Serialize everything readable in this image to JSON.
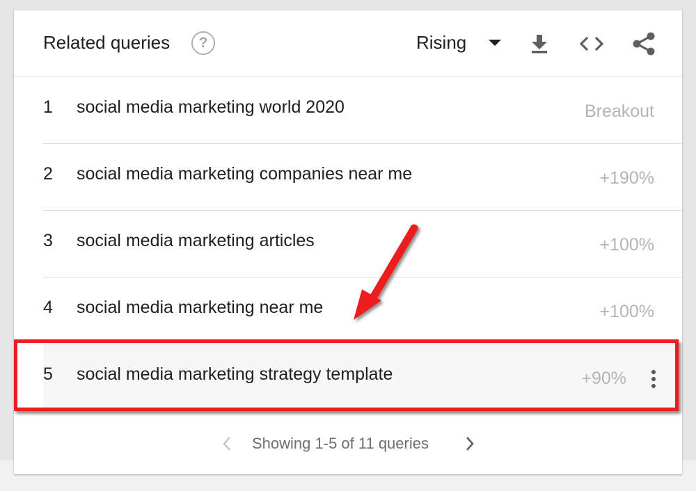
{
  "widget": {
    "title": "Related queries",
    "help_icon": "help-circle-icon",
    "filter": {
      "selected": "Rising"
    },
    "toolbar": {
      "download_icon": "download-icon",
      "embed_icon": "embed-code-icon",
      "share_icon": "share-icon"
    }
  },
  "rows": [
    {
      "rank": "1",
      "query": "social media marketing world 2020",
      "value": "Breakout"
    },
    {
      "rank": "2",
      "query": "social media marketing companies near me",
      "value": "+190%"
    },
    {
      "rank": "3",
      "query": "social media marketing articles",
      "value": "+100%"
    },
    {
      "rank": "4",
      "query": "social media marketing near me",
      "value": "+100%"
    },
    {
      "rank": "5",
      "query": "social media marketing strategy template",
      "value": "+90%"
    }
  ],
  "pagination": {
    "text": "Showing 1-5 of 11 queries"
  },
  "annotation": {
    "color": "#ee1c1c"
  }
}
